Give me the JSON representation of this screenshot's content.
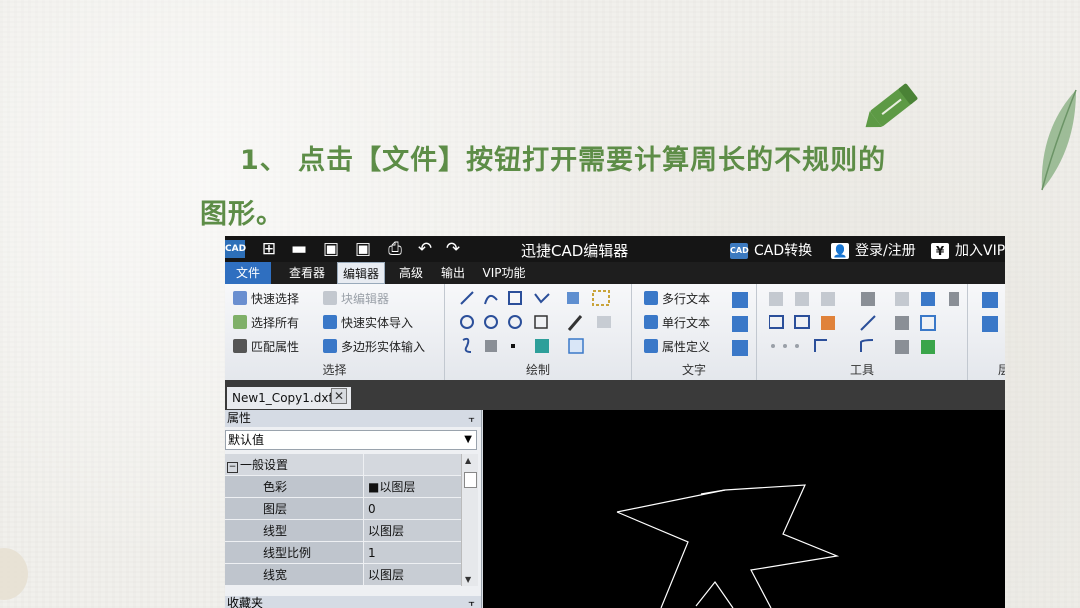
{
  "heading": {
    "line1": "1、 点击【文件】按钮打开需要计算周长的不规则的",
    "line2": "图形。"
  },
  "colors": {
    "heading": "#5d8d47",
    "accent": "#2f6fc0"
  },
  "app": {
    "logo": "CAD",
    "title": "迅捷CAD编辑器",
    "convert": "CAD转换",
    "convert_badge": "CAD",
    "login": "登录/注册",
    "join": "加入VIP",
    "toolbar_icons": [
      "new-icon",
      "open-icon",
      "save-icon",
      "save-as-icon",
      "print-icon",
      "undo-icon",
      "redo-icon"
    ]
  },
  "menu": {
    "file": "文件",
    "tabs": [
      "查看器",
      "编辑器",
      "高级",
      "输出",
      "VIP功能"
    ],
    "active": "编辑器"
  },
  "ribbon": {
    "select": {
      "label": "选择",
      "items": [
        "快速选择",
        "选择所有",
        "匹配属性",
        "块编辑器",
        "快速实体导入",
        "多边形实体输入"
      ]
    },
    "draw": {
      "label": "绘制"
    },
    "text": {
      "label": "文字",
      "items": [
        "多行文本",
        "单行文本",
        "属性定义"
      ]
    },
    "tools": {
      "label": "工具"
    },
    "layers": {
      "label": "层"
    }
  },
  "document": {
    "tab": "New1_Copy1.dxf",
    "close": "✕"
  },
  "properties": {
    "title": "属性",
    "pin": "⫟",
    "dropdown": "默认值",
    "section": "一般设置",
    "rows": [
      {
        "key": "色彩",
        "value": "■以图层"
      },
      {
        "key": "图层",
        "value": "0"
      },
      {
        "key": "线型",
        "value": "以图层"
      },
      {
        "key": "线型比例",
        "value": "1"
      },
      {
        "key": "线宽",
        "value": "以图层"
      }
    ],
    "favorites": "收藏夹"
  }
}
